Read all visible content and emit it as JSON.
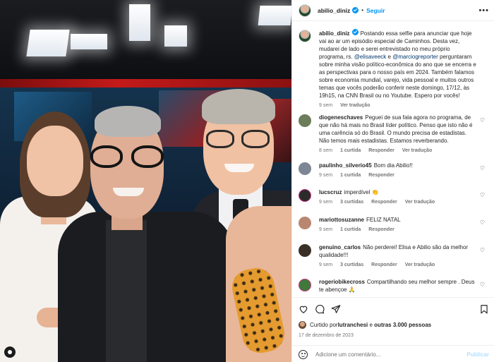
{
  "post": {
    "author": "abilio_diniz",
    "follow_label": "Seguir",
    "separator": "•",
    "more_label": "•••"
  },
  "caption": {
    "user": "abilio_diniz",
    "text_1": "Postando essa selfie para anunciar que hoje vai ao ar um episódio especial de Caminhos. Desta vez, mudarei de lado e serei entrevistado no meu próprio programa, rs.",
    "mention_1": "@elisaveeck",
    "conj": " e ",
    "mention_2": "@marciogreporter",
    "text_2": " perguntaram sobre minha visão político-econômica do ano que se encerra e as perspectivas para o nosso país em 2024. Também falamos sobre economia mundial, varejo, vida pessoal e muitos outros temas que vocês poderão conferir neste domingo, 17/12, às 19h15, na CNN Brasil ou no Youtube. Espero por vocês!",
    "time": "9 sem",
    "translation": "Ver tradução"
  },
  "comments": [
    {
      "user": "diogeneschaves",
      "text": "Peguei de sua fala agora no programa, de que não há mais no Brasil líder político. Penso que isto não é uma carência só do Brasil. O mundo precisa de estadistas. Não temos mais estadistas. Estamos reverberando.",
      "time": "8 sem",
      "likes": "1 curtida",
      "reply": "Responder",
      "translation": "Ver tradução",
      "avatar_color": "#6b7d5a"
    },
    {
      "user": "paulinho_silverio45",
      "text": "Bom dia Abilio!!",
      "time": "9 sem",
      "likes": "1 curtida",
      "reply": "Responder",
      "translation": "",
      "avatar_color": "#7c8694"
    },
    {
      "user": "lucscruz",
      "text": "imperdível 👏",
      "time": "9 sem",
      "likes": "3 curtidas",
      "reply": "Responder",
      "translation": "Ver tradução",
      "avatar_color": "#2b2b2b"
    },
    {
      "user": "mariottosuzanne",
      "text": "FELIZ NATAL",
      "time": "9 sem",
      "likes": "1 curtida",
      "reply": "Responder",
      "translation": "",
      "avatar_color": "#b9876f"
    },
    {
      "user": "genuino_carlos",
      "text": "Não perderei! Elisa e Abilio são da melhor qualidade!!!",
      "time": "9 sem",
      "likes": "3 curtidas",
      "reply": "Responder",
      "translation": "Ver tradução",
      "avatar_color": "#3a3026"
    },
    {
      "user": "rogeriobikecross",
      "text": "Compartilhando seu melhor sempre . Deus te abençoe 🙏",
      "time": "",
      "likes": "",
      "reply": "",
      "translation": "",
      "avatar_color": "#3f7a3b"
    }
  ],
  "icons": {
    "like": "heart-icon",
    "comment": "comment-icon",
    "share": "share-icon",
    "save": "bookmark-icon"
  },
  "likes_summary": {
    "prefix": "Curtido por ",
    "user": "lutranchesi",
    "suffix_conj": " e ",
    "others": "outras 3.000 pessoas"
  },
  "date": "17 de dezembro de 2023",
  "add_comment": {
    "placeholder": "Adicione um comentário...",
    "publish_label": "Publicar"
  },
  "colors": {
    "accent": "#0095f6",
    "publish_disabled": "#b2dffc",
    "muted": "#737373",
    "text": "#262626"
  }
}
